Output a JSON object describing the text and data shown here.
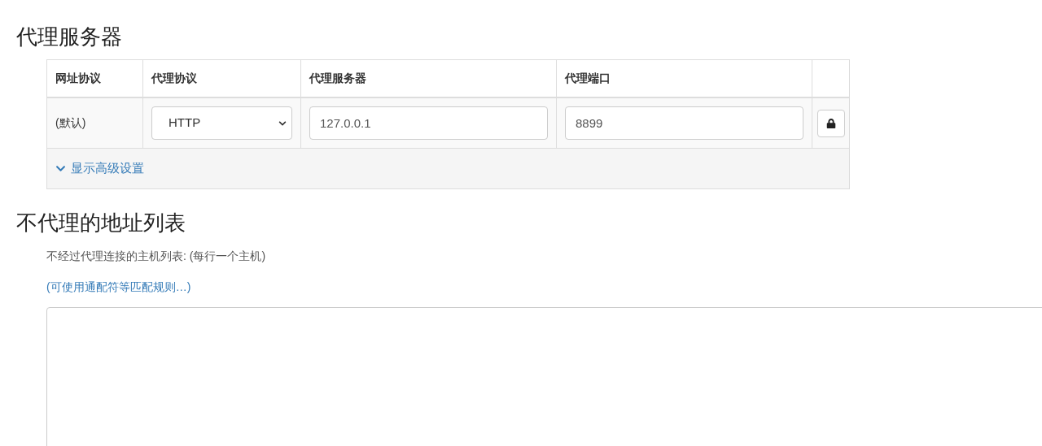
{
  "proxy_section": {
    "title": "代理服务器",
    "table": {
      "columns": [
        "网址协议",
        "代理协议",
        "代理服务器",
        "代理端口"
      ],
      "rows": [
        {
          "scheme": "(默认)",
          "protocol": "HTTP",
          "server": "127.0.0.1",
          "port": "8899"
        }
      ],
      "advanced_toggle": {
        "label": "显示高级设置",
        "expanded": false
      }
    }
  },
  "bypass_section": {
    "title": "不代理的地址列表",
    "description": "不经过代理连接的主机列表: (每行一个主机)",
    "help_link": "(可使用通配符等匹配规则…)"
  }
}
